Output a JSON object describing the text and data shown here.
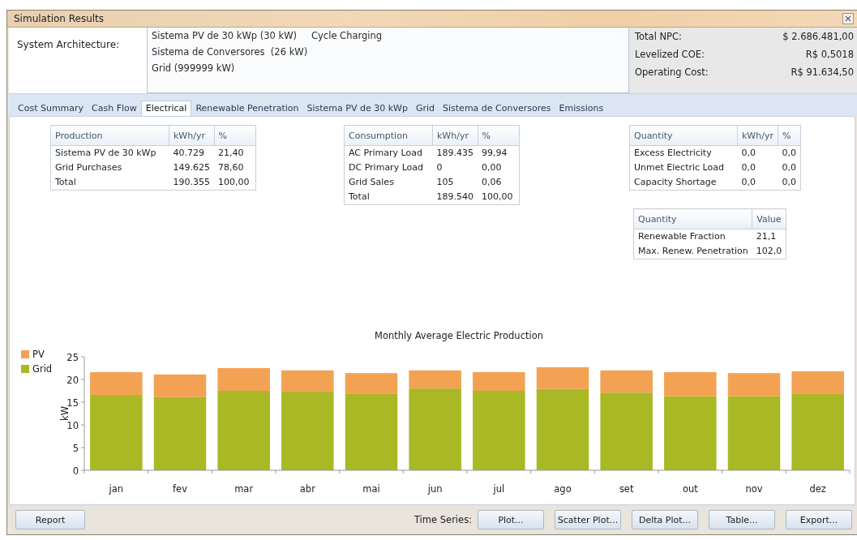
{
  "window": {
    "title": "Simulation Results"
  },
  "architecture": {
    "label": "System Architecture:",
    "lines": [
      [
        "Sistema PV de 30 kWp (30 kW)",
        "Cycle Charging"
      ],
      [
        "Sistema de Conversores  (26 kW)"
      ],
      [
        "Grid (999999 kW)"
      ]
    ]
  },
  "costs": [
    {
      "label": "Total NPC:",
      "value": "$ 2.686.481,00"
    },
    {
      "label": "Levelized COE:",
      "value": "R$ 0,5018"
    },
    {
      "label": "Operating Cost:",
      "value": "R$ 91.634,50"
    }
  ],
  "tabs": [
    {
      "label": "Cost Summary",
      "selected": false
    },
    {
      "label": "Cash Flow",
      "selected": false
    },
    {
      "label": "Electrical",
      "selected": true
    },
    {
      "label": "Renewable Penetration",
      "selected": false
    },
    {
      "label": "Sistema PV de 30 kWp",
      "selected": false
    },
    {
      "label": "Grid",
      "selected": false
    },
    {
      "label": "Sistema de Conversores",
      "selected": false
    },
    {
      "label": "Emissions",
      "selected": false
    }
  ],
  "tables": [
    {
      "columns": [
        "Production",
        "kWh/yr",
        "%"
      ],
      "rows": [
        [
          "Sistema PV de 30 kWp",
          "40.729",
          "21,40"
        ],
        [
          "Grid Purchases",
          "149.625",
          "78,60"
        ],
        [
          "Total",
          "190.355",
          "100,00"
        ]
      ]
    },
    {
      "columns": [
        "Consumption",
        "kWh/yr",
        "%"
      ],
      "rows": [
        [
          "AC Primary Load",
          "189.435",
          "99,94"
        ],
        [
          "DC Primary Load",
          "0",
          "0,00"
        ],
        [
          "Grid Sales",
          "105",
          "0,06"
        ],
        [
          "Total",
          "189.540",
          "100,00"
        ]
      ]
    },
    {
      "columns": [
        "Quantity",
        "kWh/yr",
        "%"
      ],
      "rows": [
        [
          "Excess Electricity",
          "0,0",
          "0,0"
        ],
        [
          "Unmet Electric Load",
          "0,0",
          "0,0"
        ],
        [
          "Capacity Shortage",
          "0,0",
          "0,0"
        ]
      ]
    },
    {
      "columns": [
        "Quantity",
        "Value"
      ],
      "rows": [
        [
          "Renewable Fraction",
          "21,1"
        ],
        [
          "Max. Renew. Penetration",
          "102,0"
        ]
      ]
    }
  ],
  "chart_data": {
    "type": "bar",
    "title": "Monthly Average Electric Production",
    "ylabel": "kW",
    "stacked": true,
    "categories": [
      "jan",
      "fev",
      "mar",
      "abr",
      "mai",
      "jun",
      "jul",
      "ago",
      "set",
      "out",
      "nov",
      "dez"
    ],
    "legend": "top-left",
    "ylim": [
      0,
      25
    ],
    "yticks": [
      0,
      5,
      10,
      15,
      20,
      25
    ],
    "series": [
      {
        "name": "PV",
        "color": "#f3a254",
        "values": [
          5.0,
          5.0,
          5.0,
          4.7,
          4.6,
          4.0,
          4.1,
          4.8,
          4.9,
          5.3,
          5.1,
          5.0
        ]
      },
      {
        "name": "Grid",
        "color": "#a9b824",
        "values": [
          16.6,
          16.1,
          17.5,
          17.3,
          16.8,
          18.0,
          17.5,
          17.9,
          17.1,
          16.3,
          16.3,
          16.8
        ]
      }
    ]
  },
  "footer": {
    "report": "Report",
    "time_series_label": "Time Series:",
    "buttons": [
      "Plot...",
      "Scatter Plot...",
      "Delta Plot...",
      "Table...",
      "Export..."
    ]
  }
}
